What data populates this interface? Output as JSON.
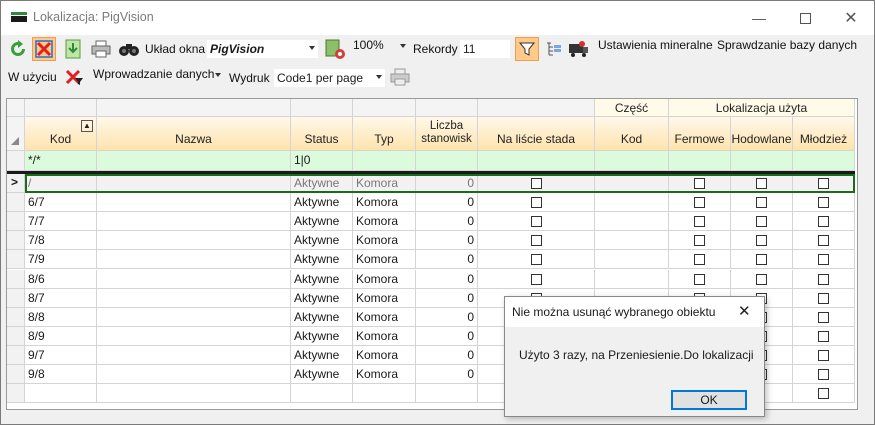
{
  "window": {
    "title": "Lokalizacja: PigVision"
  },
  "toolbar": {
    "layout_label": "Układ okna",
    "layout_value": "PigVision",
    "zoom": "100%",
    "records_label": "Rekordy",
    "records_value": "11",
    "mineral_settings": "Ustawienia mineralne",
    "check_db": "Sprawdzanie bazy danych",
    "in_use": "W użyciu",
    "data_entry": "Wprowadzanie danych",
    "print_label": "Wydruk",
    "print_value": "Code1 per page"
  },
  "grid": {
    "group_headers": {
      "czesc": "Część",
      "lokalizacja": "Lokalizacja użyta"
    },
    "columns": {
      "kod": "Kod",
      "nazwa": "Nazwa",
      "status": "Status",
      "typ": "Typ",
      "liczba": "Liczba stanowisk",
      "na_liscie": "Na liście stada",
      "czesc_kod": "Kod",
      "fermowe": "Fermowe",
      "hodowlane": "Hodowlane",
      "mlodziez": "Młodzież"
    },
    "filter": {
      "kod": "*/*",
      "status": "1|0"
    },
    "current_row_marker": ">",
    "rows": [
      {
        "kod": "/",
        "status": "Aktywne",
        "typ": "Komora",
        "liczba": "0"
      },
      {
        "kod": "6/7",
        "status": "Aktywne",
        "typ": "Komora",
        "liczba": "0"
      },
      {
        "kod": "7/7",
        "status": "Aktywne",
        "typ": "Komora",
        "liczba": "0"
      },
      {
        "kod": "7/8",
        "status": "Aktywne",
        "typ": "Komora",
        "liczba": "0"
      },
      {
        "kod": "7/9",
        "status": "Aktywne",
        "typ": "Komora",
        "liczba": "0"
      },
      {
        "kod": "8/6",
        "status": "Aktywne",
        "typ": "Komora",
        "liczba": "0"
      },
      {
        "kod": "8/7",
        "status": "Aktywne",
        "typ": "Komora",
        "liczba": "0"
      },
      {
        "kod": "8/8",
        "status": "Aktywne",
        "typ": "Komora",
        "liczba": "0"
      },
      {
        "kod": "8/9",
        "status": "Aktywne",
        "typ": "Komora",
        "liczba": "0"
      },
      {
        "kod": "9/7",
        "status": "Aktywne",
        "typ": "Komora",
        "liczba": "0"
      },
      {
        "kod": "9/8",
        "status": "Aktywne",
        "typ": "Komora",
        "liczba": "0"
      }
    ]
  },
  "dialog": {
    "title": "Nie można usunąć wybranego obiektu",
    "message": "Użyto 3 razy, na Przeniesienie.Do lokalizacji",
    "ok": "OK"
  },
  "colors": {
    "header": "#ffe3ad",
    "filter_row": "#dcfadc",
    "selected_border": "#1a6b1a"
  }
}
